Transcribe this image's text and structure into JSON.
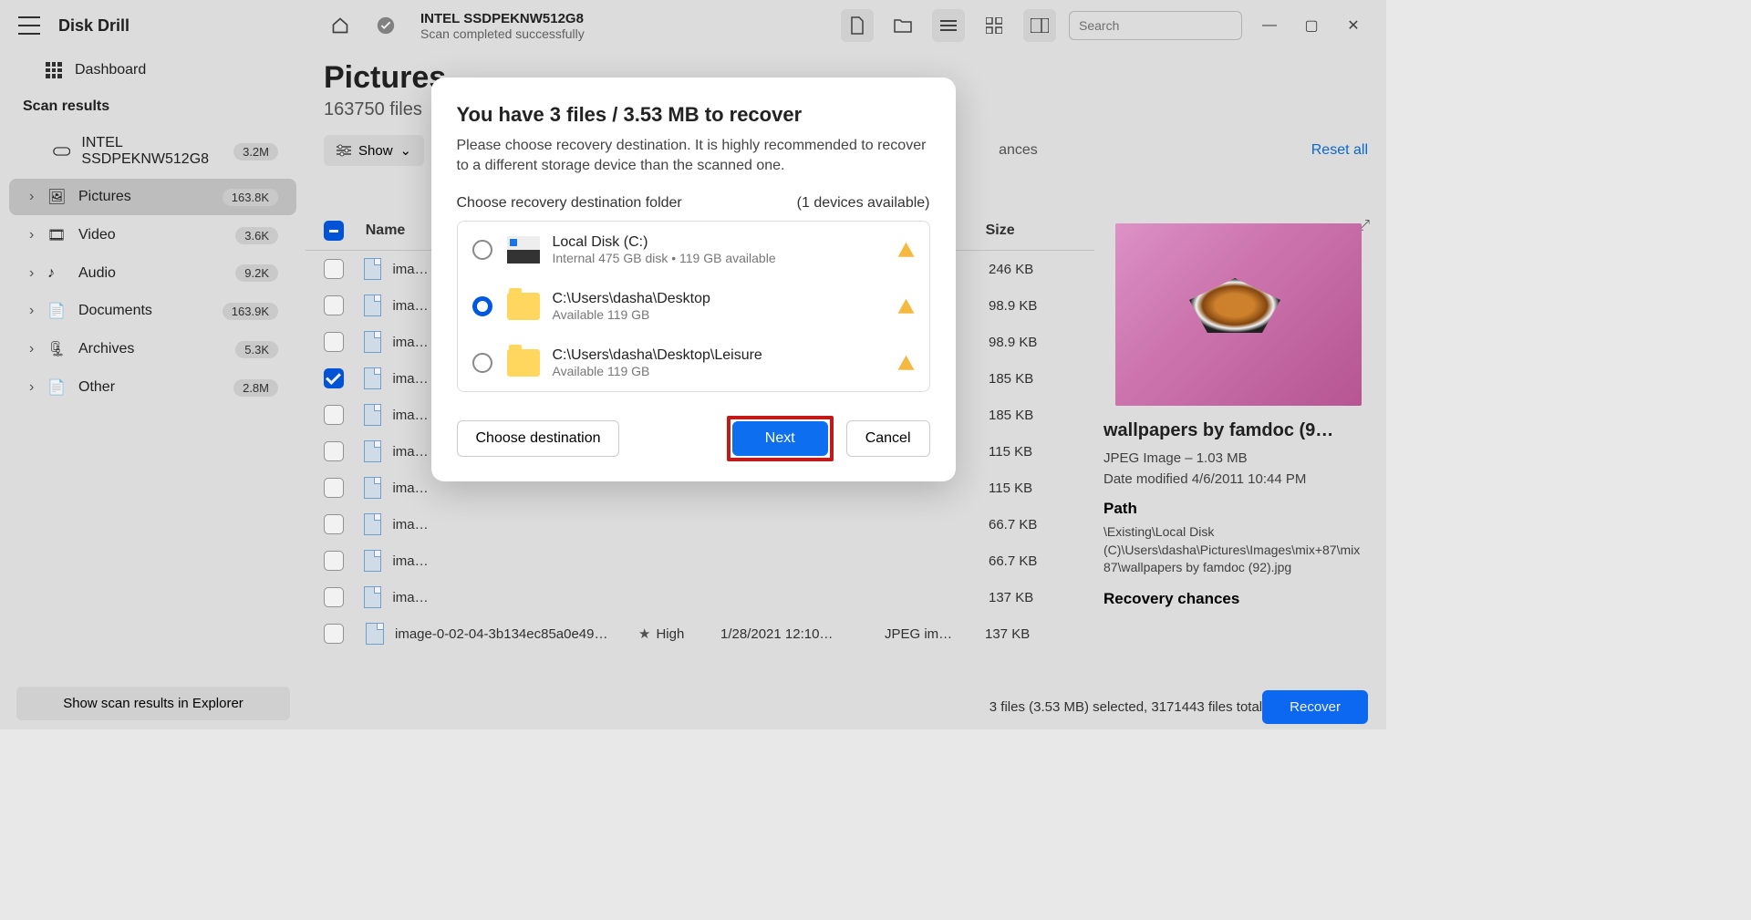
{
  "app": {
    "title": "Disk Drill"
  },
  "sidebar": {
    "dashboard": "Dashboard",
    "section": "Scan results",
    "disk": {
      "label": "INTEL SSDPEKNW512G8",
      "count": "3.2M"
    },
    "cats": [
      {
        "label": "Pictures",
        "count": "163.8K",
        "active": true
      },
      {
        "label": "Video",
        "count": "3.6K"
      },
      {
        "label": "Audio",
        "count": "9.2K"
      },
      {
        "label": "Documents",
        "count": "163.9K"
      },
      {
        "label": "Archives",
        "count": "5.3K"
      },
      {
        "label": "Other",
        "count": "2.8M"
      }
    ],
    "explorer_btn": "Show scan results in Explorer"
  },
  "header": {
    "disk_name": "INTEL SSDPEKNW512G8",
    "status": "Scan completed successfully",
    "search_placeholder": "Search"
  },
  "page": {
    "title": "Pictures",
    "subtitle": "163750 files",
    "show": "Show",
    "chances": "ances",
    "reset": "Reset all"
  },
  "table": {
    "headers": {
      "name": "Name",
      "size": "Size"
    },
    "rows": [
      {
        "name": "ima…",
        "size": "246 KB",
        "checked": false
      },
      {
        "name": "ima…",
        "size": "98.9 KB",
        "checked": false
      },
      {
        "name": "ima…",
        "size": "98.9 KB",
        "checked": false
      },
      {
        "name": "ima…",
        "size": "185 KB",
        "checked": true
      },
      {
        "name": "ima…",
        "size": "185 KB",
        "checked": false
      },
      {
        "name": "ima…",
        "size": "115 KB",
        "checked": false
      },
      {
        "name": "ima…",
        "size": "115 KB",
        "checked": false
      },
      {
        "name": "ima…",
        "size": "66.7 KB",
        "checked": false
      },
      {
        "name": "ima…",
        "size": "66.7 KB",
        "checked": false
      },
      {
        "name": "ima…",
        "size": "137 KB",
        "checked": false
      },
      {
        "name": "image-0-02-04-3b134ec85a0e49…",
        "size": "137 KB",
        "checked": false,
        "chance": "High",
        "date": "1/28/2021 12:10…",
        "type": "JPEG im…"
      }
    ]
  },
  "details": {
    "title": "wallpapers by famdoc (9…",
    "type": "JPEG Image – 1.03 MB",
    "date": "Date modified 4/6/2011 10:44 PM",
    "path_label": "Path",
    "path": "\\Existing\\Local Disk (C)\\Users\\dasha\\Pictures\\Images\\mix+87\\mix 87\\wallpapers by famdoc (92).jpg",
    "rec_label": "Recovery chances"
  },
  "footer": {
    "status": "3 files (3.53 MB) selected, 3171443 files total",
    "recover": "Recover"
  },
  "modal": {
    "title": "You have 3 files / 3.53 MB to recover",
    "desc": "Please choose recovery destination. It is highly recommended to recover to a different storage device than the scanned one.",
    "sub_left": "Choose recovery destination folder",
    "sub_right": "(1 devices available)",
    "dests": [
      {
        "name": "Local Disk (C:)",
        "detail": "Internal 475 GB disk • 119 GB available",
        "type": "disk",
        "selected": false
      },
      {
        "name": "C:\\Users\\dasha\\Desktop",
        "detail": "Available 119 GB",
        "type": "folder",
        "selected": true
      },
      {
        "name": "C:\\Users\\dasha\\Desktop\\Leisure",
        "detail": "Available 119 GB",
        "type": "folder",
        "selected": false
      }
    ],
    "choose": "Choose destination",
    "next": "Next",
    "cancel": "Cancel"
  }
}
